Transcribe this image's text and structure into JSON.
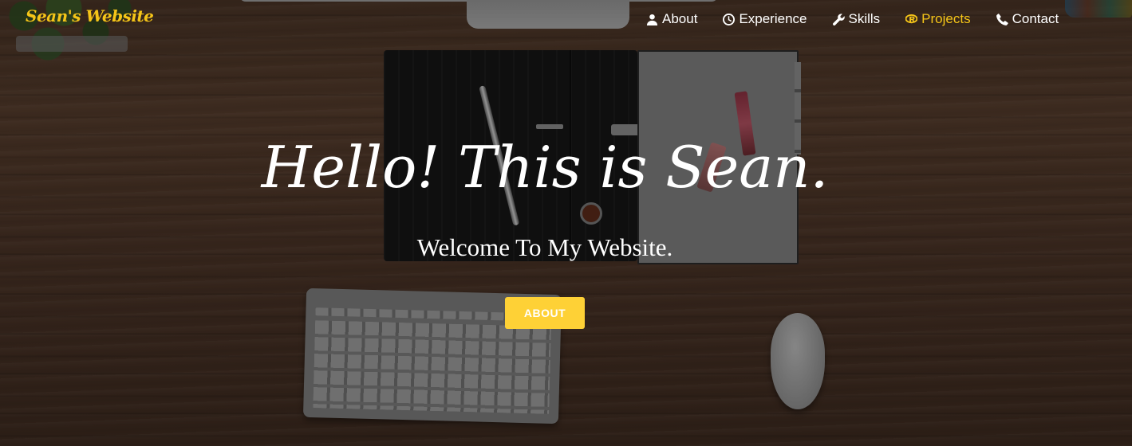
{
  "brand": {
    "name": "Sean's Website"
  },
  "nav": {
    "items": [
      {
        "label": "About",
        "icon": "user-icon",
        "active": false
      },
      {
        "label": "Experience",
        "icon": "clock-icon",
        "active": false
      },
      {
        "label": "Skills",
        "icon": "wrench-icon",
        "active": false
      },
      {
        "label": "Projects",
        "icon": "r-project-icon",
        "active": true
      },
      {
        "label": "Contact",
        "icon": "phone-icon",
        "active": false
      }
    ]
  },
  "hero": {
    "title": "Hello! This is Sean.",
    "subtitle": "Welcome To My Website.",
    "button_label": "ABOUT"
  },
  "colors": {
    "accent": "#fed136",
    "nav_active": "#f5c518",
    "text": "#ffffff"
  }
}
